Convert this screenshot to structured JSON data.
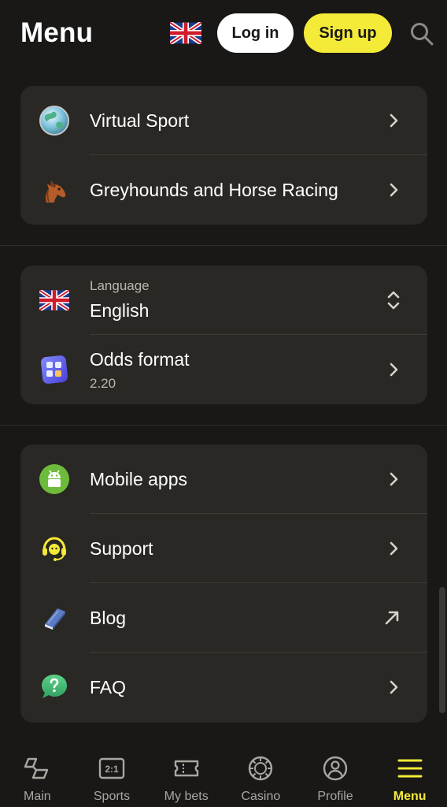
{
  "header": {
    "title": "Menu",
    "flag_icon": "uk-flag-icon",
    "login_label": "Log in",
    "signup_label": "Sign up",
    "search_icon": "search-icon"
  },
  "sports_card": {
    "items": [
      {
        "label": "Virtual Sport",
        "icon": "globe-icon"
      },
      {
        "label": "Greyhounds and Horse Racing",
        "icon": "horse-icon"
      }
    ]
  },
  "settings_card": {
    "language": {
      "caption": "Language",
      "value": "English",
      "icon": "uk-flag-icon"
    },
    "odds": {
      "label": "Odds format",
      "value": "2.20",
      "icon": "calculator-icon"
    }
  },
  "info_card": {
    "items": [
      {
        "label": "Mobile apps",
        "icon": "android-icon"
      },
      {
        "label": "Support",
        "icon": "headset-icon"
      },
      {
        "label": "Blog",
        "icon": "book-icon"
      },
      {
        "label": "FAQ",
        "icon": "question-chat-icon"
      }
    ]
  },
  "bottom_nav": {
    "items": [
      {
        "label": "Main",
        "icon": "main-icon"
      },
      {
        "label": "Sports",
        "icon": "sports-icon"
      },
      {
        "label": "My bets",
        "icon": "ticket-icon"
      },
      {
        "label": "Casino",
        "icon": "chip-icon"
      },
      {
        "label": "Profile",
        "icon": "profile-icon"
      },
      {
        "label": "Menu",
        "icon": "menu-icon"
      }
    ],
    "active": "Menu"
  },
  "colors": {
    "background": "#191817",
    "card": "#2a2824",
    "accent_yellow": "#f4ea38",
    "muted_text": "#b9b6ae"
  }
}
